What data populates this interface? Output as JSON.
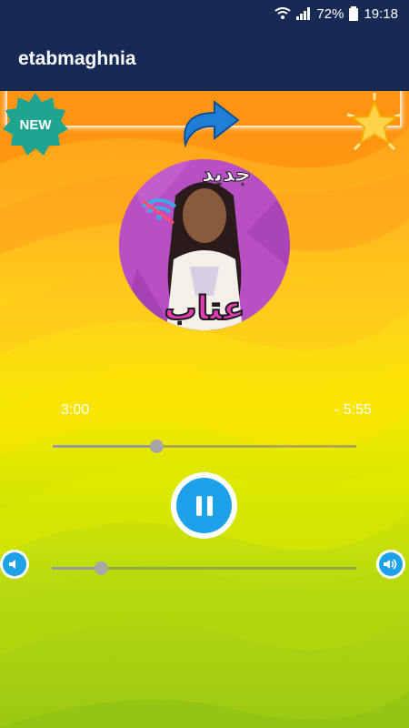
{
  "status_bar": {
    "battery": "72%",
    "time": "19:18",
    "icons": [
      "wifi-icon",
      "signal-icon",
      "battery-icon"
    ]
  },
  "app_bar": {
    "title": "etabmaghnia"
  },
  "badges": {
    "new_label": "NEW"
  },
  "cover": {
    "text_top": "جديد",
    "text_bottom": "عتاب"
  },
  "player": {
    "current_time": "3:00",
    "remaining_time": "- 5:55",
    "progress": 0.34,
    "state": "playing",
    "volume": 0.16
  },
  "colors": {
    "app_bar": "#172a55",
    "accent": "#1da1e8",
    "cover_bg": "#b84fc4",
    "text": "#ffffff"
  }
}
